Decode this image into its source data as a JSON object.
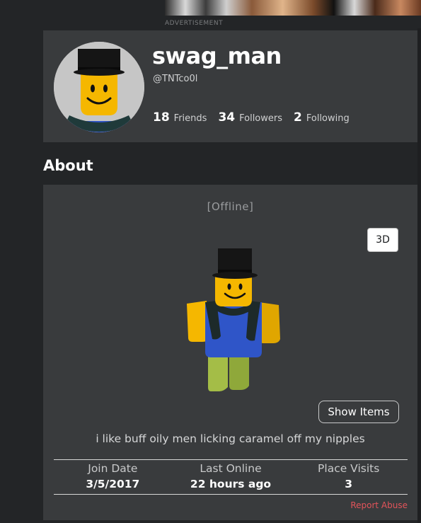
{
  "ad": {
    "label": "ADVERTISEMENT"
  },
  "profile": {
    "display_name": "swag_man",
    "username": "@TNTco0l",
    "stats": [
      {
        "count": "18",
        "label": "Friends"
      },
      {
        "count": "34",
        "label": "Followers"
      },
      {
        "count": "2",
        "label": "Following"
      }
    ]
  },
  "about": {
    "title": "About",
    "presence": "[Offline]",
    "view_toggle_label": "3D",
    "show_items_label": "Show Items",
    "blurb": "i like buff oily men licking caramel off my nipples",
    "info": [
      {
        "label": "Join Date",
        "value": "3/5/2017"
      },
      {
        "label": "Last Online",
        "value": "22 hours ago"
      },
      {
        "label": "Place Visits",
        "value": "3"
      }
    ],
    "report_label": "Report Abuse"
  },
  "colors": {
    "page_bg": "#232527",
    "card_bg": "#393b3d",
    "report_link": "#e2545a",
    "avatar_torso": "#2f55c8",
    "avatar_skin": "#f5b700",
    "avatar_legs": "#a4bd47"
  }
}
